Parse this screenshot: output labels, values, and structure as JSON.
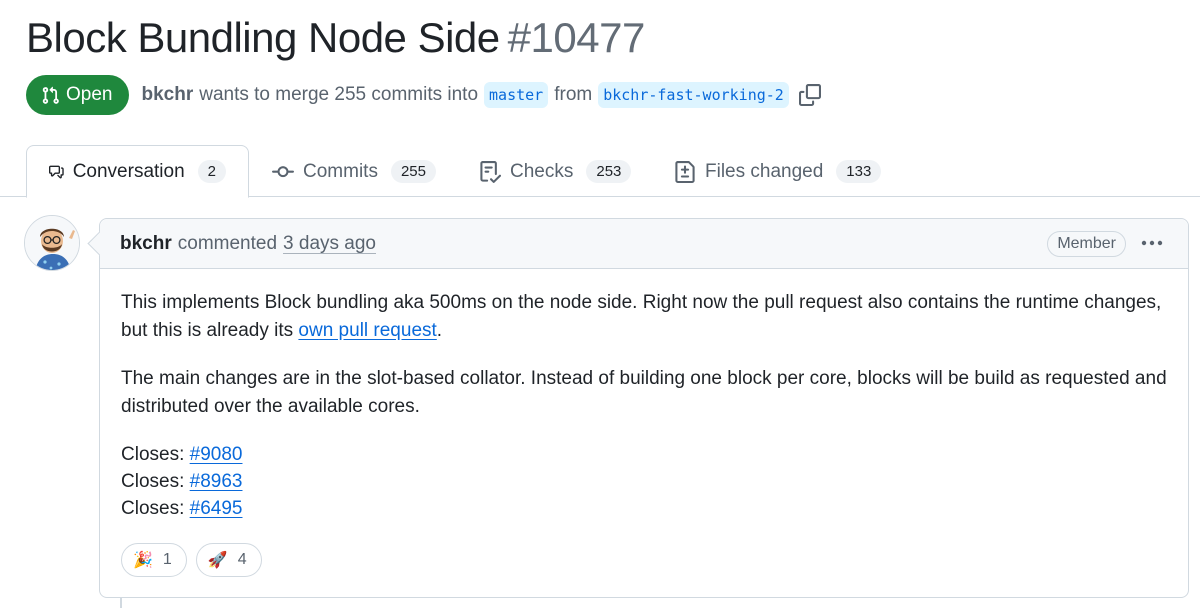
{
  "pr": {
    "title": "Block Bundling Node Side",
    "number": "#10477",
    "state_label": "Open",
    "author": "bkchr",
    "merge_text": "wants to merge 255 commits into",
    "base_branch": "master",
    "from_text": "from",
    "head_branch": "bkchr-fast-working-2"
  },
  "tabs": [
    {
      "label": "Conversation",
      "count": "2",
      "icon": "comment-discussion-icon"
    },
    {
      "label": "Commits",
      "count": "255",
      "icon": "git-commit-icon"
    },
    {
      "label": "Checks",
      "count": "253",
      "icon": "checklist-icon"
    },
    {
      "label": "Files changed",
      "count": "133",
      "icon": "file-diff-icon"
    }
  ],
  "comment": {
    "author": "bkchr",
    "action": "commented",
    "time": "3 days ago",
    "role": "Member",
    "p1_text": "This implements Block bundling aka 500ms on the node side. Right now the pull request also contains the runtime changes, but this is already its ",
    "p1_link": "own pull request",
    "p1_end": ".",
    "p2": "The main changes are in the slot-based collator. Instead of building one block per core, blocks will be build as requested and distributed over the available cores.",
    "closes_label": "Closes:",
    "closes": [
      "#9080",
      "#8963",
      "#6495"
    ]
  },
  "reactions": [
    {
      "emoji": "🎉",
      "count": "1"
    },
    {
      "emoji": "🚀",
      "count": "4"
    }
  ],
  "colors": {
    "open_green": "#1f883d",
    "link_blue": "#0969da",
    "branch_bg": "#ddf4ff",
    "border": "#d1d9e0"
  }
}
